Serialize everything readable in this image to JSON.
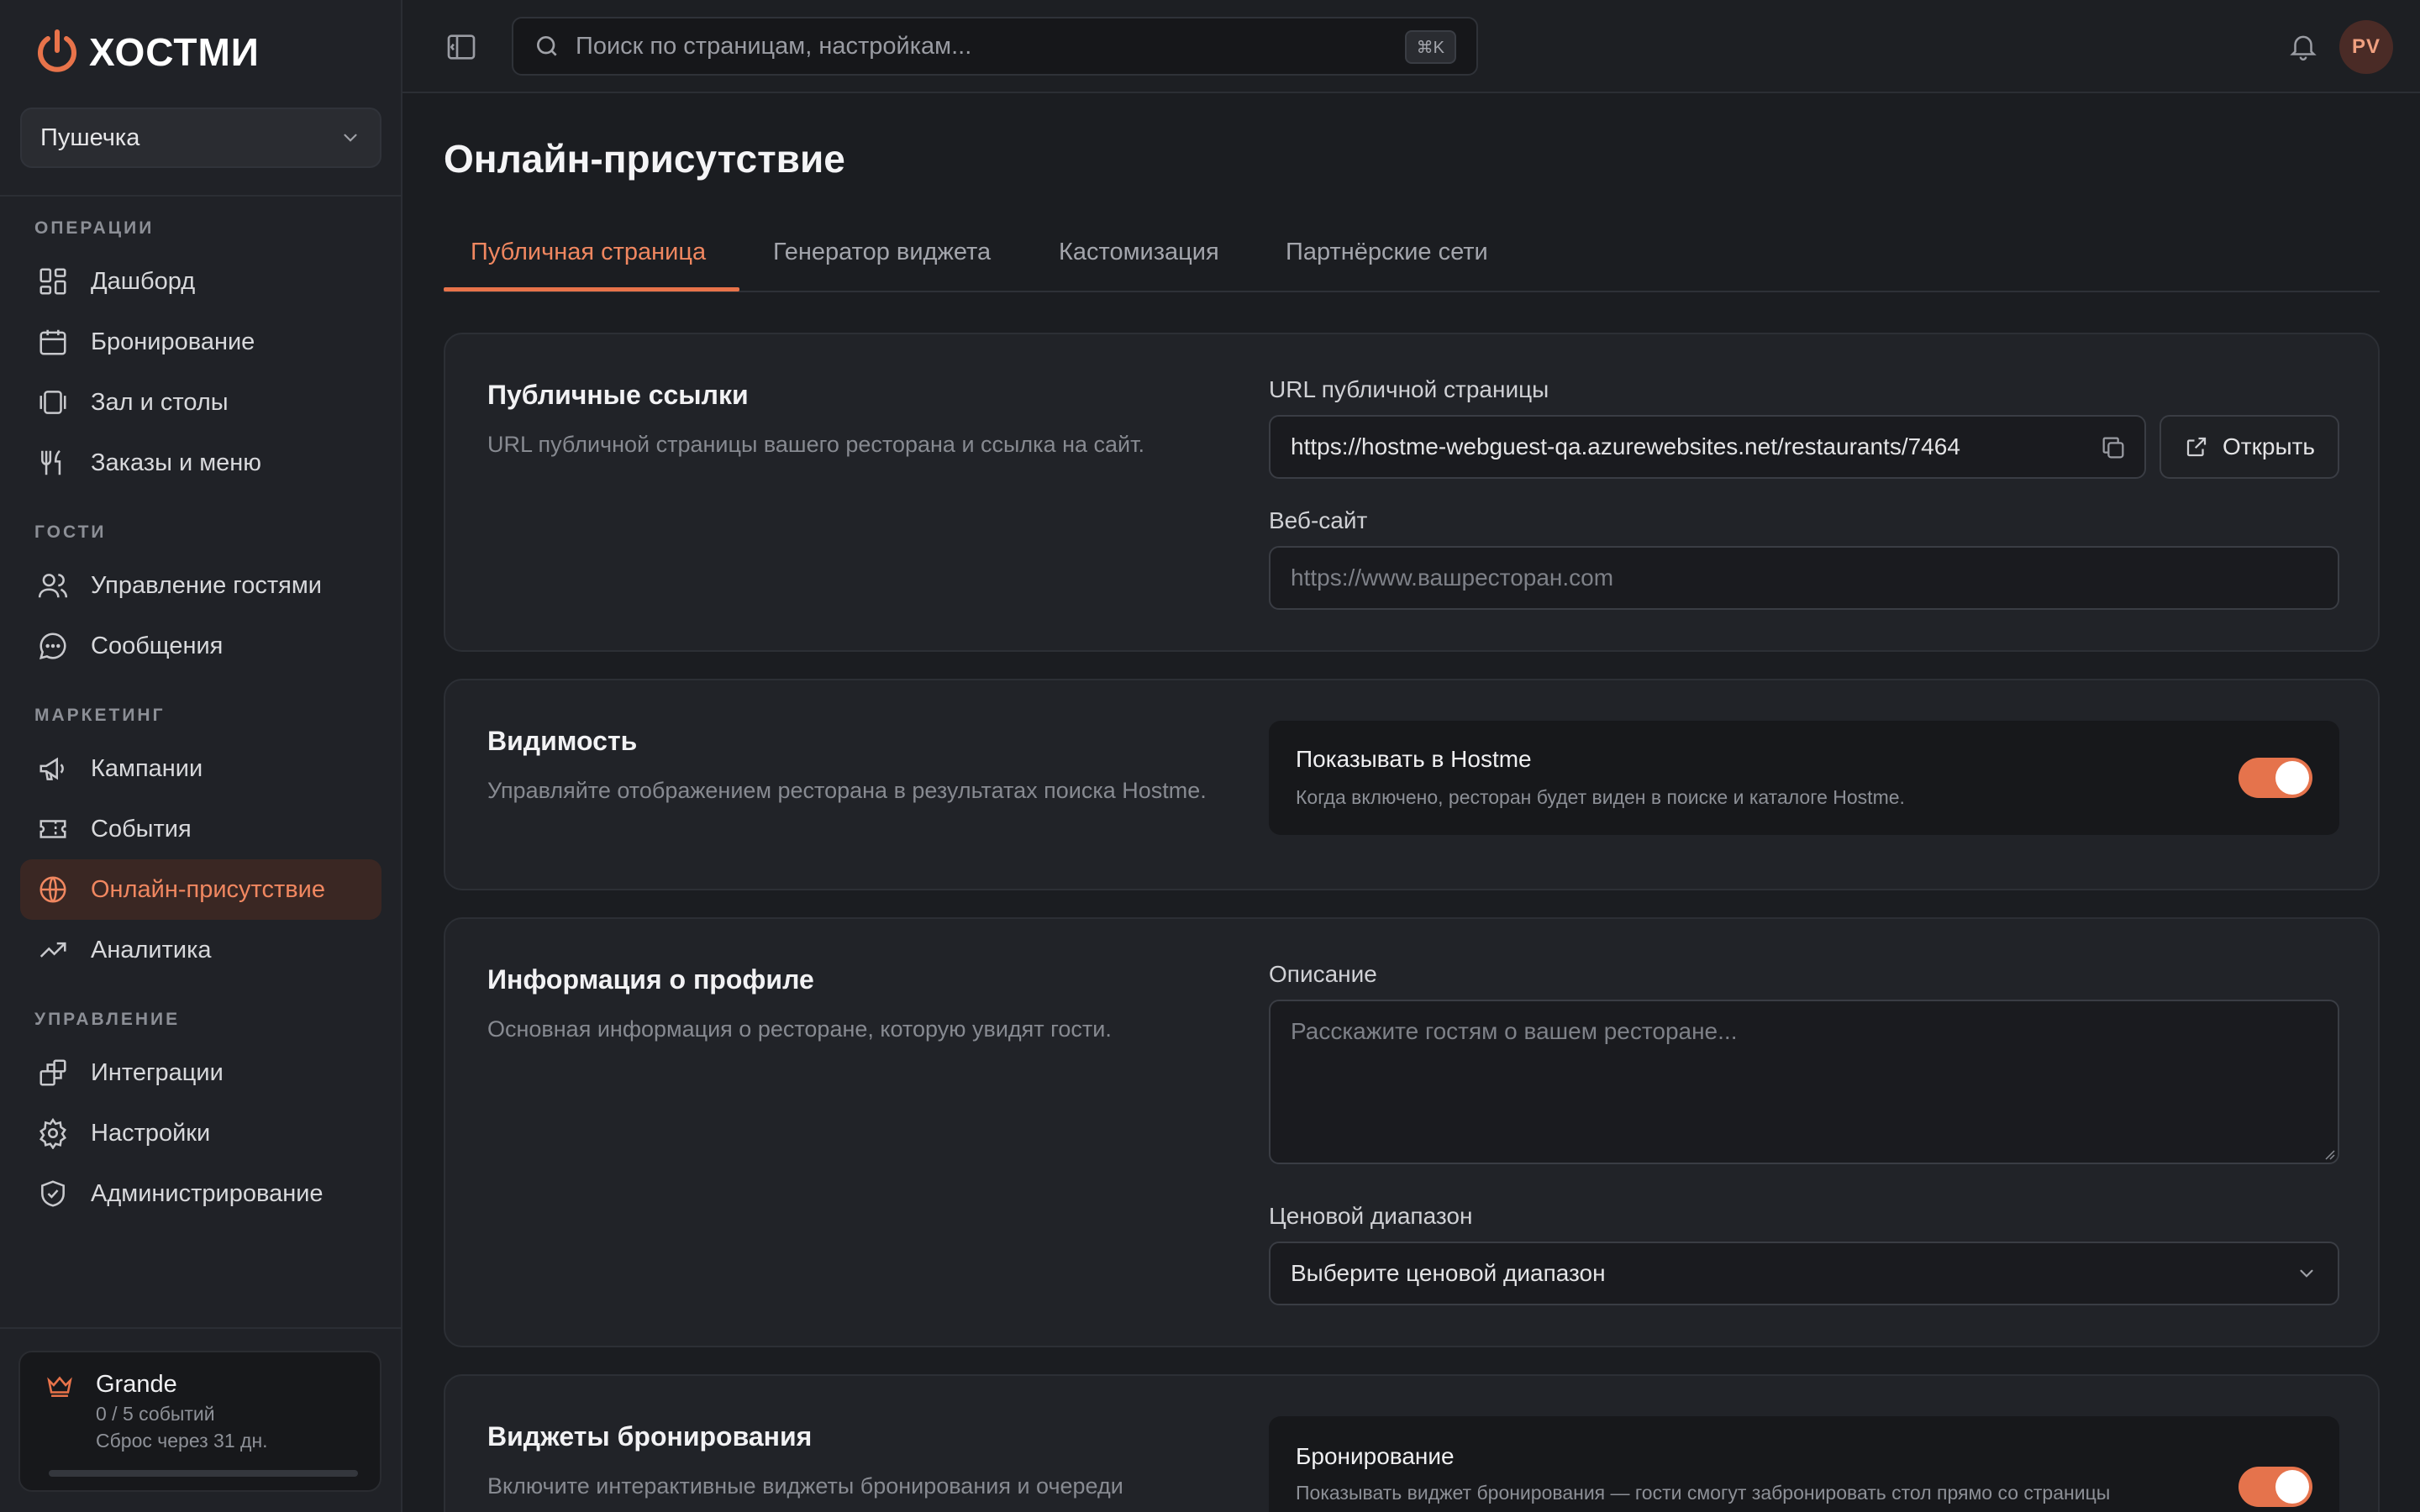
{
  "app": {
    "logo_text": "ХОСТМИ",
    "accent": "#e8734a"
  },
  "workspace": {
    "name": "Пушечка"
  },
  "sidebar": {
    "sections": [
      {
        "title": "ОПЕРАЦИИ"
      },
      {
        "title": "ГОСТИ"
      },
      {
        "title": "МАРКЕТИНГ"
      },
      {
        "title": "УПРАВЛЕНИЕ"
      }
    ],
    "items": [
      {
        "label": "Дашборд",
        "icon": "dashboard-icon"
      },
      {
        "label": "Бронирование",
        "icon": "calendar-icon"
      },
      {
        "label": "Зал и столы",
        "icon": "tables-icon"
      },
      {
        "label": "Заказы и меню",
        "icon": "utensils-icon"
      },
      {
        "label": "Управление гостями",
        "icon": "users-icon"
      },
      {
        "label": "Сообщения",
        "icon": "message-icon"
      },
      {
        "label": "Кампании",
        "icon": "megaphone-icon"
      },
      {
        "label": "События",
        "icon": "ticket-icon"
      },
      {
        "label": "Онлайн-присутствие",
        "icon": "globe-icon",
        "active": true
      },
      {
        "label": "Аналитика",
        "icon": "trend-icon"
      },
      {
        "label": "Интеграции",
        "icon": "integrations-icon"
      },
      {
        "label": "Настройки",
        "icon": "gear-icon"
      },
      {
        "label": "Администрирование",
        "icon": "shield-icon"
      }
    ]
  },
  "plan": {
    "name": "Grande",
    "usage": "0 / 5 событий",
    "reset": "Сброс через 31 дн.",
    "progress": 0
  },
  "topbar": {
    "search_placeholder": "Поиск по страницам, настройкам...",
    "shortcut": "⌘K",
    "avatar_initials": "PV"
  },
  "page": {
    "title": "Онлайн-присутствие",
    "tabs": [
      {
        "label": "Публичная страница",
        "active": true
      },
      {
        "label": "Генератор виджета"
      },
      {
        "label": "Кастомизация"
      },
      {
        "label": "Партнёрские сети"
      }
    ]
  },
  "public_links": {
    "title": "Публичные ссылки",
    "description": "URL публичной страницы вашего ресторана и ссылка на сайт.",
    "url_label": "URL публичной страницы",
    "url_value": "https://hostme-webguest-qa.azurewebsites.net/restaurants/7464",
    "open_label": "Открыть",
    "website_label": "Веб-сайт",
    "website_placeholder": "https://www.вашресторан.com"
  },
  "visibility": {
    "title": "Видимость",
    "description": "Управляйте отображением ресторана в результатах поиска Hostme.",
    "toggle_title": "Показывать в Hostme",
    "toggle_desc": "Когда включено, ресторан будет виден в поиске и каталоге Hostme.",
    "enabled": true
  },
  "profile": {
    "title": "Информация о профиле",
    "description": "Основная информация о ресторане, которую увидят гости.",
    "desc_label": "Описание",
    "desc_placeholder": "Расскажите гостям о вашем ресторане...",
    "price_label": "Ценовой диапазон",
    "price_value": "Выберите ценовой диапазон"
  },
  "widgets": {
    "title": "Виджеты бронирования",
    "description": "Включите интерактивные виджеты бронирования и очереди",
    "toggle_title": "Бронирование",
    "toggle_desc": "Показывать виджет бронирования — гости смогут забронировать стол прямо со страницы",
    "enabled": true
  }
}
